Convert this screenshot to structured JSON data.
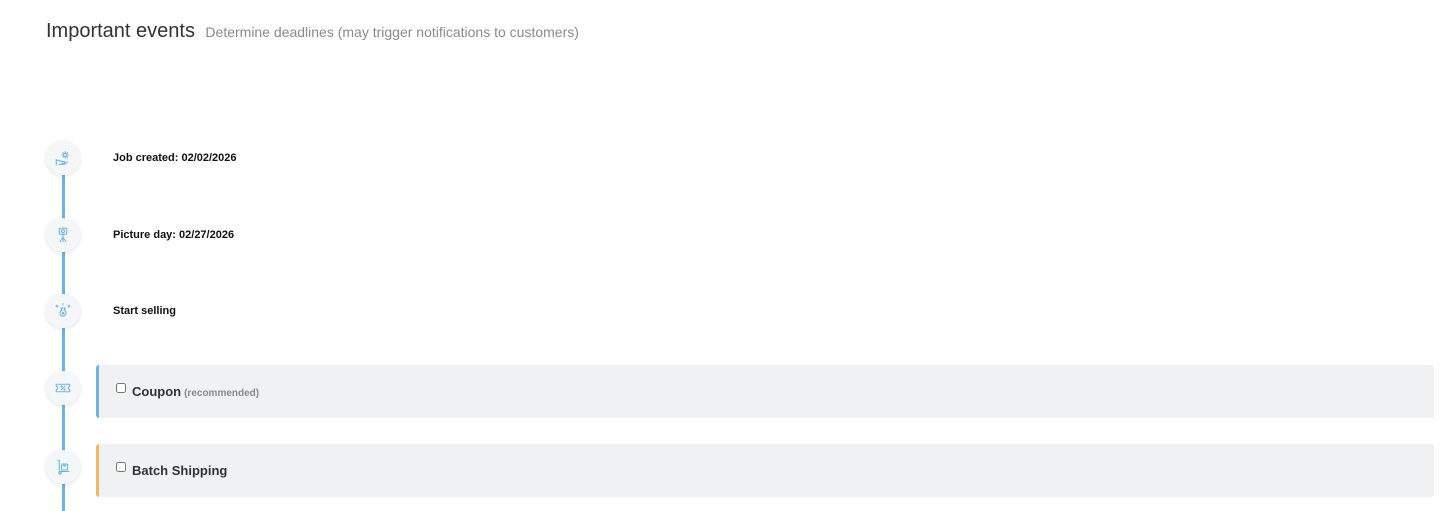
{
  "header": {
    "title": "Important events",
    "subtitle": "Determine deadlines (may trigger notifications to customers)"
  },
  "events": [
    {
      "label": "Job created: 02/02/2026",
      "icon": "gear-hand-icon"
    },
    {
      "label": "Picture day: 02/27/2026",
      "icon": "camera-tripod-icon"
    },
    {
      "label": "Start selling",
      "icon": "sparkle-money-icon"
    }
  ],
  "options": [
    {
      "label": "Coupon",
      "note": "(recommended)",
      "icon": "coupon-ticket-icon",
      "checked": false,
      "accent": "#6fb3e0"
    },
    {
      "label": "Batch Shipping",
      "icon": "hand-truck-box-icon",
      "checked": false,
      "accent": "#f5b66a"
    }
  ],
  "colors": {
    "timeline": "#6fb3e0",
    "card_background": "#f0f1f3"
  }
}
